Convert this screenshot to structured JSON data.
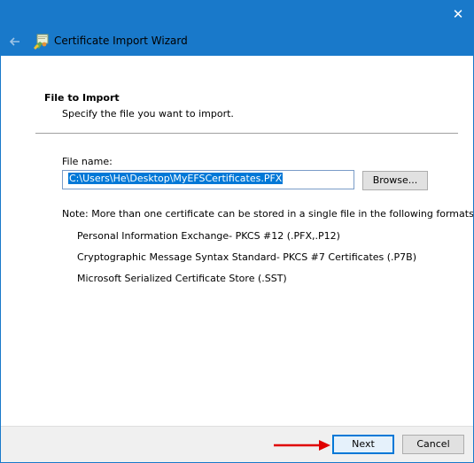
{
  "window": {
    "close_glyph": "✕",
    "back_icon": "back-arrow-icon",
    "wizard_icon": "certificate-wizard-icon",
    "title": "Certificate Import Wizard"
  },
  "page": {
    "heading": "File to Import",
    "subheading": "Specify the file you want to import."
  },
  "file": {
    "label": "File name:",
    "value": "C:\\Users\\He\\Desktop\\MyEFSCertificates.PFX",
    "browse_label": "Browse..."
  },
  "note": {
    "text": "Note:  More than one certificate can be stored in a single file in the following formats:",
    "formats": [
      "Personal Information Exchange- PKCS #12 (.PFX,.P12)",
      "Cryptographic Message Syntax Standard- PKCS #7 Certificates (.P7B)",
      "Microsoft Serialized Certificate Store (.SST)"
    ]
  },
  "footer": {
    "next_label": "Next",
    "cancel_label": "Cancel"
  },
  "colors": {
    "accent": "#1979ca",
    "selection": "#0078d7",
    "annotation_arrow": "#e00000"
  }
}
